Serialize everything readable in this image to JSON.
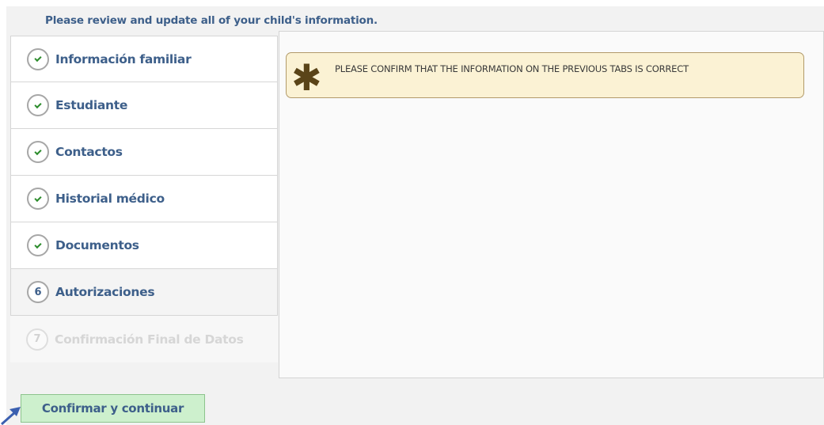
{
  "intro_text": "Please review and update all of your child's information.",
  "alert": {
    "icon": "asterisk-icon",
    "message": "PLEASE CONFIRM THAT THE INFORMATION ON THE PREVIOUS TABS IS CORRECT"
  },
  "steps": [
    {
      "label": "Información familiar",
      "status": "done"
    },
    {
      "label": "Estudiante",
      "status": "done"
    },
    {
      "label": "Contactos",
      "status": "done"
    },
    {
      "label": "Historial médico",
      "status": "done"
    },
    {
      "label": "Documentos",
      "status": "done"
    },
    {
      "label": "Autorizaciones",
      "number": "6",
      "status": "current"
    },
    {
      "label": "Confirmación Final de Datos",
      "number": "7",
      "status": "disabled"
    }
  ],
  "confirm_button": "Confirmar y continuar",
  "colors": {
    "accent_text": "#3d5f8a",
    "alert_background": "#fbf2d4",
    "button_background": "#cdf0cd",
    "check": "#2c8c2c"
  }
}
